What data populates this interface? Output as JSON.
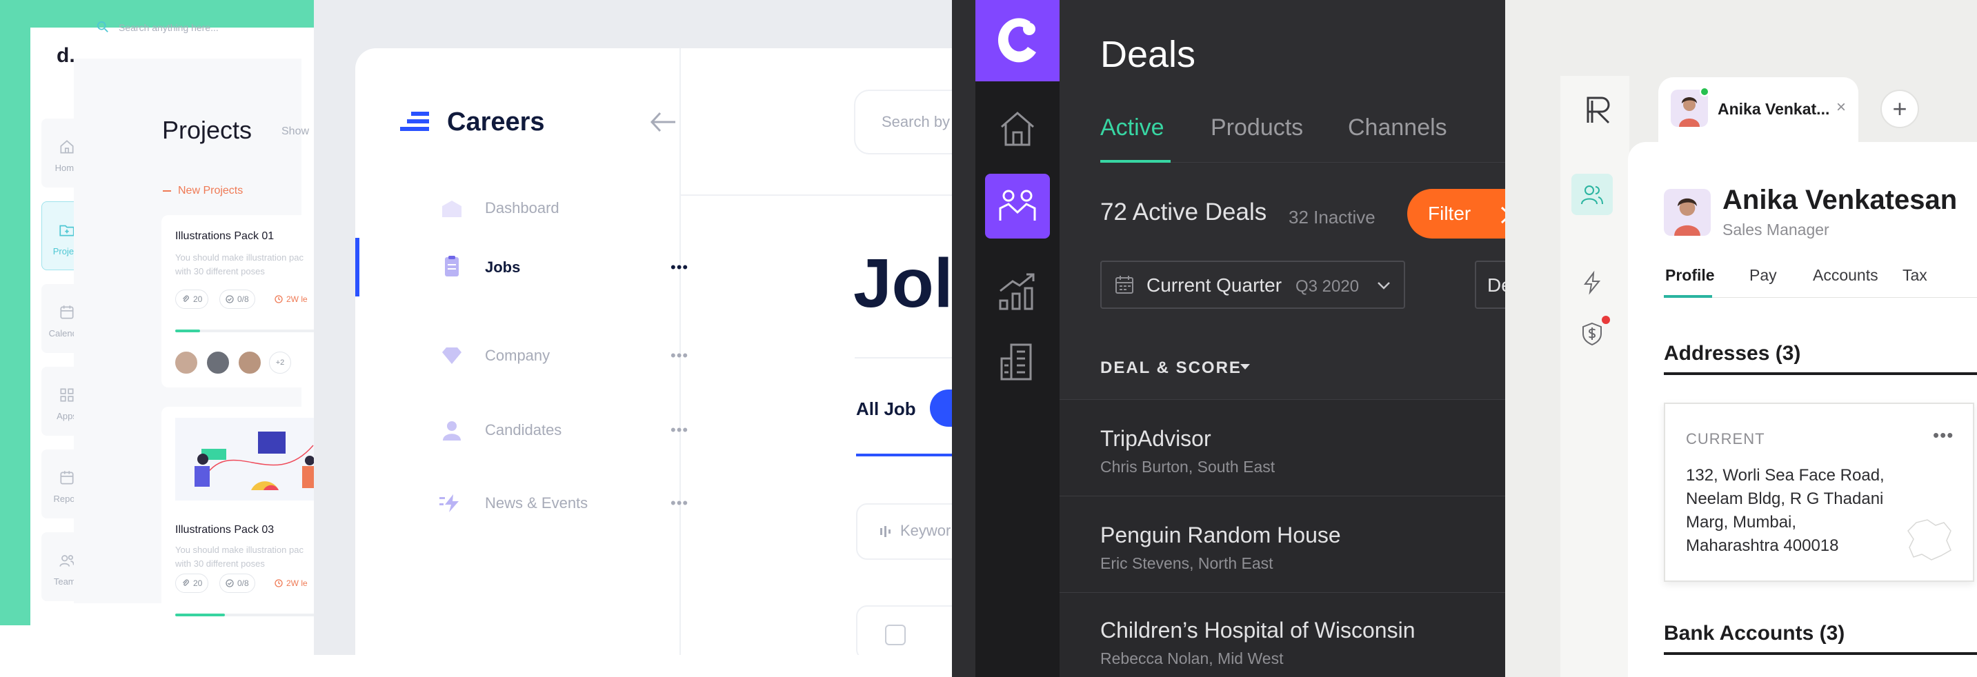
{
  "panel1": {
    "logo": "d.",
    "search_placeholder": "Search anything here...",
    "sidebar": [
      {
        "label": "Home",
        "icon": "home-icon"
      },
      {
        "label": "Project",
        "icon": "folder-icon",
        "active": true
      },
      {
        "label": "Calendar",
        "icon": "calendar-icon"
      },
      {
        "label": "Apps",
        "icon": "apps-icon"
      },
      {
        "label": "Report",
        "icon": "report-icon"
      },
      {
        "label": "Teams",
        "icon": "teams-icon"
      }
    ],
    "title": "Projects",
    "show_label": "Show",
    "section_label": "New Projects",
    "cards": [
      {
        "title": "Illustrations Pack 01",
        "desc_line1": "You should make illustration pac",
        "desc_line2": "with 30 different poses",
        "attachments": "20",
        "tasks": "0/8",
        "due": "2W le",
        "progress": 0.15,
        "avatars_more": "+2"
      },
      {
        "title": "Illustrations Pack 03",
        "desc_line1": "You should make illustration pac",
        "desc_line2": "with 30 different poses",
        "attachments": "20",
        "tasks": "0/8",
        "due": "2W le",
        "progress": 0.3
      }
    ],
    "colors": {
      "bg": "#5fdbb1",
      "accent": "#38d4a0",
      "orange": "#ef7a55"
    }
  },
  "panel2": {
    "brand": "Careers",
    "nav": [
      {
        "label": "Dashboard",
        "icon": "dashboard-icon"
      },
      {
        "label": "Jobs",
        "icon": "clipboard-icon",
        "active": true,
        "more": "•••"
      },
      {
        "label": "Company",
        "icon": "diamond-icon",
        "more": "•••"
      },
      {
        "label": "Candidates",
        "icon": "person-icon",
        "more": "•••"
      },
      {
        "label": "News & Events",
        "icon": "lightning-icon",
        "more": "•••"
      }
    ],
    "search_placeholder": "Search by",
    "heading": "Jol",
    "tab_all": "All Job",
    "keyword_placeholder": "Keywor",
    "colors": {
      "accent": "#2a52ff",
      "dark": "#101a3c"
    }
  },
  "panel3": {
    "title": "Deals",
    "tabs": [
      "Active",
      "Products",
      "Channels"
    ],
    "active_count": "72 Active Deals",
    "inactive_count": "32 Inactive",
    "filter_label": "Filter",
    "period_label": "Current Quarter",
    "period_sub": "Q3 2020",
    "second_dropdown": "De",
    "sort_label": "DEAL & SCORE",
    "deals": [
      {
        "name": "TripAdvisor",
        "sub": "Chris Burton, South East"
      },
      {
        "name": "Penguin Random House",
        "sub": "Eric Stevens, North East"
      },
      {
        "name": "Children’s Hospital of Wisconsin",
        "sub": "Rebecca Nolan, Mid West"
      }
    ],
    "colors": {
      "accent": "#38d6a3",
      "purple": "#8147ff",
      "orange": "#ff6a1f"
    }
  },
  "panel4": {
    "tab_name": "Anika Venkat...",
    "tab_close": "×",
    "add_tab": "+",
    "name": "Anika Venkatesan",
    "role": "Sales Manager",
    "tabs": [
      "Profile",
      "Pay",
      "Accounts",
      "Tax"
    ],
    "addresses_title": "Addresses (3)",
    "address_label": "CURRENT",
    "address_more": "•••",
    "address_lines": [
      "132, Worli Sea Face Road,",
      "Neelam Bldg, R G Thadani",
      "Marg, Mumbai,",
      "Maharashtra 400018"
    ],
    "bank_title": "Bank Accounts (3)",
    "colors": {
      "accent": "#2ab4a0"
    }
  }
}
